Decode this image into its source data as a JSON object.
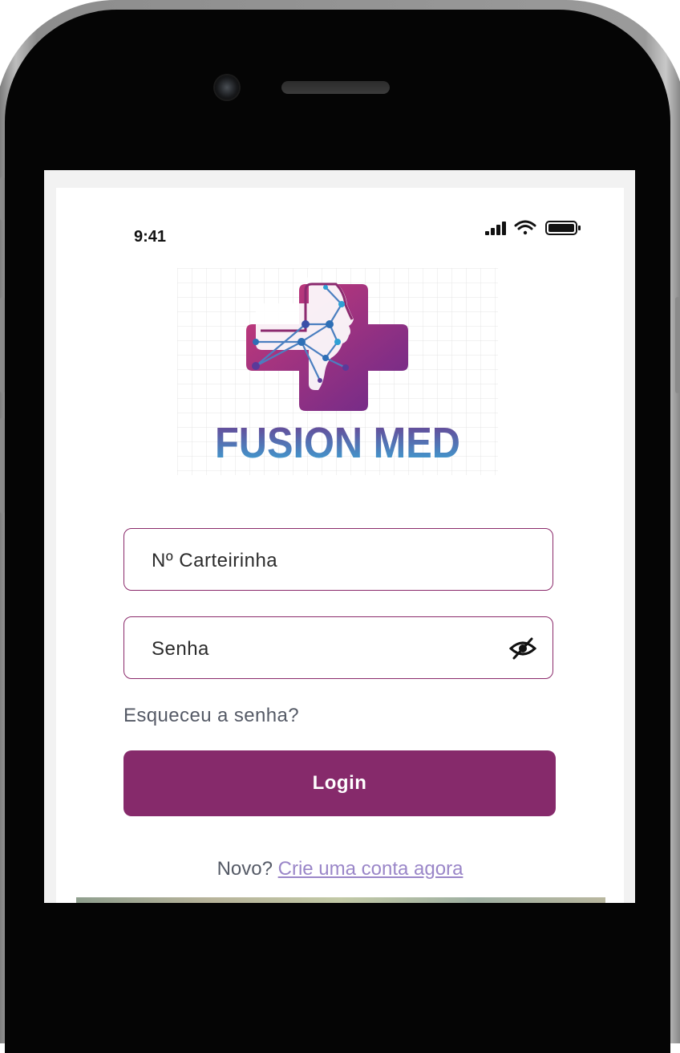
{
  "status_bar": {
    "time": "9:41"
  },
  "logo": {
    "name": "FUSION MED"
  },
  "form": {
    "card_number": {
      "placeholder": "Nº Carteirinha",
      "value": ""
    },
    "password": {
      "placeholder": "Senha",
      "value": ""
    },
    "forgot_password": "Esqueceu a senha?",
    "login_button": "Login",
    "signup_prefix": "Novo?",
    "signup_link": "Crie uma conta agora"
  },
  "colors": {
    "primary": "#862a6b",
    "input_border": "#8b2a6b",
    "link": "#9a86c8",
    "logo_text_top": "#6d3b8e",
    "logo_text_bottom": "#3aa9d8"
  },
  "icons": [
    "camera-icon",
    "signal-icon",
    "wifi-icon",
    "battery-icon",
    "eye-slash-icon"
  ]
}
